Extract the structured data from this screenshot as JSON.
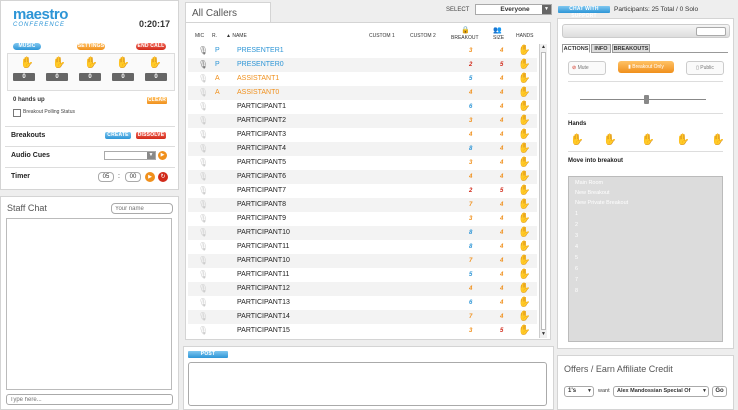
{
  "brand": {
    "logo_main": "maestro",
    "logo_sub": "CONFERENCE"
  },
  "timer_display": "0:20:17",
  "controls": {
    "music_label": "MUSIC",
    "settings_label": "SETTINGS",
    "end_call_label": "END CALL"
  },
  "hands_counts": [
    "0",
    "0",
    "0",
    "0",
    "0"
  ],
  "hands_up_text": "0 hands up",
  "clear_label": "CLEAR",
  "breakout_polling_label": "Breakout Polling Status",
  "breakouts": {
    "label": "Breakouts",
    "create_label": "CREATE",
    "dissolve_label": "DISSOLVE"
  },
  "audio_cues_label": "Audio Cues",
  "timer": {
    "label": "Timer",
    "minutes": "05",
    "seconds": "00"
  },
  "staff_chat": {
    "title": "Staff Chat",
    "name_placeholder": "Your name",
    "type_placeholder": "Type here..."
  },
  "callers": {
    "title": "All Callers",
    "select_label": "SELECT",
    "select_value": "Everyone",
    "columns": {
      "mic": "MIC",
      "role": "R.",
      "name": "NAME",
      "custom1": "CUSTOM 1",
      "custom2": "CUSTOM 2",
      "breakout": "BREAKOUT",
      "size": "SIZE",
      "hands": "HANDS"
    },
    "rows": [
      {
        "role": "P",
        "name": "PRESENTER1",
        "breakout": "3",
        "size": "4",
        "type": "presenter"
      },
      {
        "role": "P",
        "name": "PRESENTER0",
        "breakout": "2",
        "size": "5",
        "type": "presenter"
      },
      {
        "role": "A",
        "name": "ASSISTANT1",
        "breakout": "5",
        "size": "4",
        "type": "assistant"
      },
      {
        "role": "A",
        "name": "ASSISTANT0",
        "breakout": "4",
        "size": "4",
        "type": "assistant"
      },
      {
        "role": "",
        "name": "PARTICIPANT1",
        "breakout": "6",
        "size": "4",
        "type": "participant"
      },
      {
        "role": "",
        "name": "PARTICIPANT2",
        "breakout": "3",
        "size": "4",
        "type": "participant"
      },
      {
        "role": "",
        "name": "PARTICIPANT3",
        "breakout": "4",
        "size": "4",
        "type": "participant"
      },
      {
        "role": "",
        "name": "PARTICIPANT4",
        "breakout": "8",
        "size": "4",
        "type": "participant"
      },
      {
        "role": "",
        "name": "PARTICIPANT5",
        "breakout": "3",
        "size": "4",
        "type": "participant"
      },
      {
        "role": "",
        "name": "PARTICIPANT6",
        "breakout": "4",
        "size": "4",
        "type": "participant"
      },
      {
        "role": "",
        "name": "PARTICIPANT7",
        "breakout": "2",
        "size": "5",
        "type": "participant"
      },
      {
        "role": "",
        "name": "PARTICIPANT8",
        "breakout": "7",
        "size": "4",
        "type": "participant"
      },
      {
        "role": "",
        "name": "PARTICIPANT9",
        "breakout": "3",
        "size": "4",
        "type": "participant"
      },
      {
        "role": "",
        "name": "PARTICIPANT10",
        "breakout": "8",
        "size": "4",
        "type": "participant"
      },
      {
        "role": "",
        "name": "PARTICIPANT11",
        "breakout": "8",
        "size": "4",
        "type": "participant"
      },
      {
        "role": "",
        "name": "PARTICIPANT10",
        "breakout": "7",
        "size": "4",
        "type": "participant"
      },
      {
        "role": "",
        "name": "PARTICIPANT11",
        "breakout": "5",
        "size": "4",
        "type": "participant"
      },
      {
        "role": "",
        "name": "PARTICIPANT12",
        "breakout": "4",
        "size": "4",
        "type": "participant"
      },
      {
        "role": "",
        "name": "PARTICIPANT13",
        "breakout": "6",
        "size": "4",
        "type": "participant"
      },
      {
        "role": "",
        "name": "PARTICIPANT14",
        "breakout": "7",
        "size": "4",
        "type": "participant"
      },
      {
        "role": "",
        "name": "PARTICIPANT15",
        "breakout": "3",
        "size": "5",
        "type": "participant"
      }
    ]
  },
  "post_message_label": "POST MESSAGE",
  "support": {
    "chat_label": "CHAT WITH SUPPORT",
    "participants_text": "Participants: 25 Total / 0 Solo"
  },
  "right_tabs": {
    "actions": "ACTIONS",
    "info": "INFO",
    "breakouts": "BREAKOUTS"
  },
  "actions": {
    "mute": "Mute",
    "breakout_only": "Breakout Only",
    "public": "Public"
  },
  "hands_label": "Hands",
  "move_into_breakout": {
    "label": "Move into breakout",
    "items": [
      "Main Room",
      "New Breakout",
      "New Private Breakout",
      "1",
      "2",
      "3",
      "4",
      "5",
      "6",
      "7",
      "8"
    ]
  },
  "offers": {
    "title": "Offers / Earn Affiliate Credit",
    "quantity": "1's",
    "want_label": "want",
    "product": "Alex Mandossian Special Of",
    "go_label": "Go"
  },
  "colors": {
    "blue": "#2d95d6",
    "orange": "#f0901c",
    "red": "#d12a1a"
  }
}
